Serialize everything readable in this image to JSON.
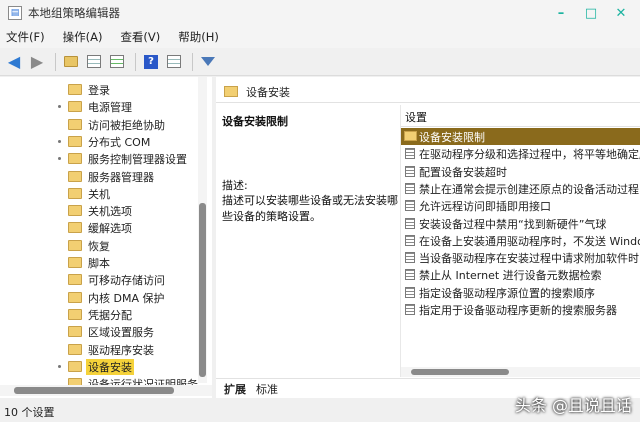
{
  "window": {
    "title": "本地组策略编辑器",
    "controls": {
      "minimize": "–",
      "maximize": "□",
      "close": "✕"
    }
  },
  "menubar": {
    "items": [
      "文件(F)",
      "操作(A)",
      "查看(V)",
      "帮助(H)"
    ]
  },
  "toolbar": {
    "buttons": [
      "back-icon",
      "forward-icon",
      "up-folder-icon",
      "show-hide-tree-icon",
      "export-icon",
      "help-icon",
      "properties-icon",
      "filter-icon"
    ]
  },
  "tree": {
    "items": [
      {
        "label": "登录",
        "bullet": false,
        "selected": false
      },
      {
        "label": "电源管理",
        "bullet": true,
        "selected": false
      },
      {
        "label": "访问被拒绝协助",
        "bullet": false,
        "selected": false
      },
      {
        "label": "分布式 COM",
        "bullet": true,
        "selected": false
      },
      {
        "label": "服务控制管理器设置",
        "bullet": true,
        "selected": false
      },
      {
        "label": "服务器管理器",
        "bullet": false,
        "selected": false
      },
      {
        "label": "关机",
        "bullet": false,
        "selected": false
      },
      {
        "label": "关机选项",
        "bullet": false,
        "selected": false
      },
      {
        "label": "缓解选项",
        "bullet": false,
        "selected": false
      },
      {
        "label": "恢复",
        "bullet": false,
        "selected": false
      },
      {
        "label": "脚本",
        "bullet": false,
        "selected": false
      },
      {
        "label": "可移动存储访问",
        "bullet": false,
        "selected": false
      },
      {
        "label": "内核 DMA 保护",
        "bullet": false,
        "selected": false
      },
      {
        "label": "凭据分配",
        "bullet": false,
        "selected": false
      },
      {
        "label": "区域设置服务",
        "bullet": false,
        "selected": false
      },
      {
        "label": "驱动程序安装",
        "bullet": false,
        "selected": false
      },
      {
        "label": "设备安装",
        "bullet": true,
        "selected": true
      },
      {
        "label": "设备运行状况证明服务",
        "bullet": false,
        "selected": false
      }
    ]
  },
  "right": {
    "header_title": "设备安装",
    "description": {
      "title": "设备安装限制",
      "label": "描述:",
      "body": "描述可以安装哪些设备或无法安装哪些设备的策略设置。"
    },
    "list_header": "设置",
    "settings": [
      {
        "label": "设备安装限制",
        "type": "folder",
        "selected": true
      },
      {
        "label": "在驱动程序分级和选择过程中，将平等地确定所有",
        "type": "policy",
        "selected": false
      },
      {
        "label": "配置设备安装超时",
        "type": "policy",
        "selected": false
      },
      {
        "label": "禁止在通常会提示创建还原点的设备活动过程中创",
        "type": "policy",
        "selected": false
      },
      {
        "label": "允许远程访问即插即用接口",
        "type": "policy",
        "selected": false
      },
      {
        "label": "安装设备过程中禁用“找到新硬件”气球",
        "type": "policy",
        "selected": false
      },
      {
        "label": "在设备上安装通用驱动程序时，不发送 Windows",
        "type": "policy",
        "selected": false
      },
      {
        "label": "当设备驱动程序在安装过程中请求附加软件时，禁",
        "type": "policy",
        "selected": false
      },
      {
        "label": "禁止从 Internet 进行设备元数据检索",
        "type": "policy",
        "selected": false
      },
      {
        "label": "指定设备驱动程序源位置的搜索顺序",
        "type": "policy",
        "selected": false
      },
      {
        "label": "指定用于设备驱动程序更新的搜索服务器",
        "type": "policy",
        "selected": false
      }
    ],
    "tabs": [
      "扩展",
      "标准"
    ]
  },
  "status": {
    "text": "10 个设置"
  },
  "watermark": "头条 @且说且话"
}
